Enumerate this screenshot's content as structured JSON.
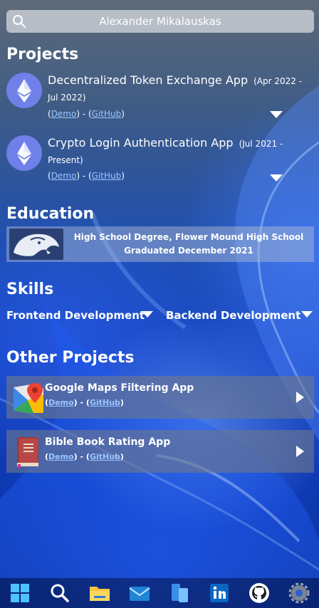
{
  "search": {
    "value": "Alexander Mikalauskas"
  },
  "sections": {
    "projects": "Projects",
    "education": "Education",
    "skills": "Skills",
    "other_projects": "Other Projects"
  },
  "projects": [
    {
      "title": "Decentralized Token Exchange App",
      "date": "(Apr 2022 - Jul 2022)",
      "demo": "Demo",
      "github": "GitHub",
      "icon": "ethereum-icon"
    },
    {
      "title": "Crypto Login Authentication App",
      "date": "(Jul 2021 - Present)",
      "demo": "Demo",
      "github": "GitHub",
      "icon": "ethereum-icon"
    }
  ],
  "education": {
    "line1": "High School Degree, Flower Mound High School",
    "line2": "Graduated December 2021",
    "icon": "panther-logo"
  },
  "skills": [
    "Frontend Development",
    "Backend Development"
  ],
  "other_projects": [
    {
      "title": "Google Maps Filtering App",
      "demo": "Demo",
      "github": "GitHub",
      "icon": "google-maps-icon"
    },
    {
      "title": "Bible Book Rating App",
      "demo": "Demo",
      "github": "GitHub",
      "icon": "book-icon"
    }
  ],
  "taskbar": [
    "windows-start-icon",
    "search-icon",
    "file-explorer-icon",
    "mail-icon",
    "phone-link-icon",
    "linkedin-icon",
    "github-icon",
    "settings-icon"
  ],
  "colors": {
    "link": "#9cc6ff",
    "ethereum_bg": "#6f80e8"
  }
}
